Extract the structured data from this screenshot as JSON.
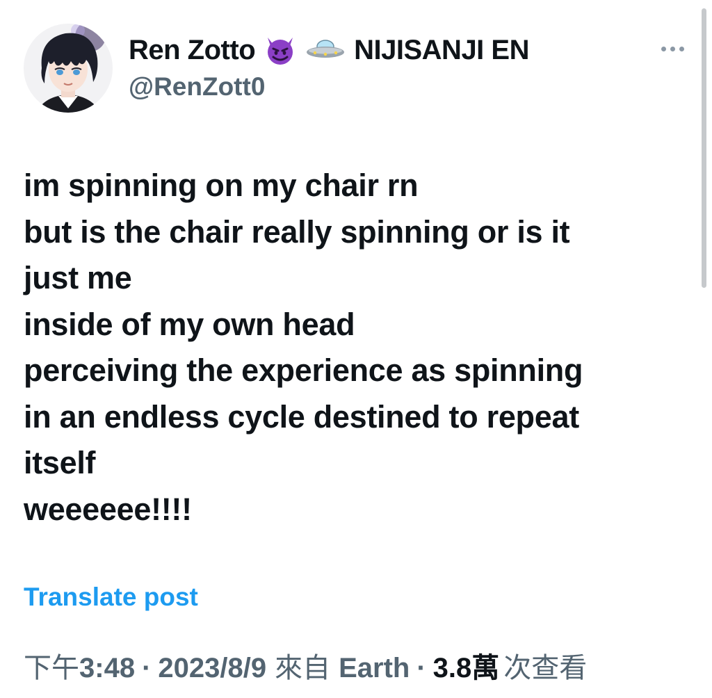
{
  "author": {
    "display_name": "Ren Zotto",
    "handle": "@RenZott0",
    "affiliation": "NIJISANJI EN",
    "name_emojis": [
      "smiling-devil-icon",
      "ufo-icon"
    ]
  },
  "post": {
    "lines": [
      "im spinning on my chair rn",
      "but is the chair really spinning or is it",
      "just me",
      "inside of my own head",
      "perceiving the experience as spinning",
      "in an endless cycle destined to repeat",
      "itself",
      "weeeeee!!!!"
    ],
    "translate_label": "Translate post"
  },
  "meta": {
    "time_prefix": "下午",
    "time": "3:48",
    "separator": "·",
    "date": "2023/8/9",
    "source_prefix": "來自",
    "source": "Earth",
    "views_count": "3.8萬",
    "views_label": "次查看"
  },
  "colors": {
    "text": "#0f1419",
    "secondary": "#536471",
    "link": "#1d9bf0",
    "devil": "#8b3fc6"
  }
}
